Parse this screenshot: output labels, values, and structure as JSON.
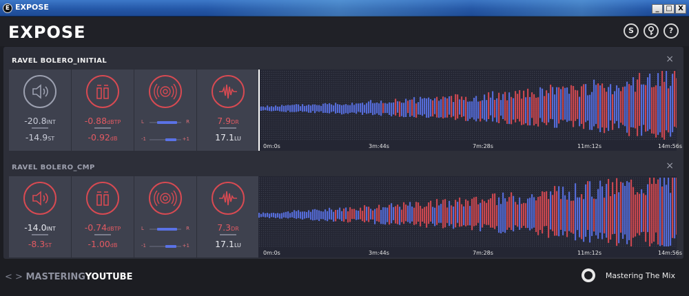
{
  "window": {
    "title": "EXPOSE",
    "app_icon": "E",
    "minimize": "_",
    "maximize": "□",
    "close": "X"
  },
  "header": {
    "logo": "EXPOSE",
    "buttons": [
      {
        "icon": "S"
      },
      {
        "icon": "key-icon"
      },
      {
        "icon": "?"
      }
    ]
  },
  "colors": {
    "red": "#d84a52",
    "blue": "#5a72e6",
    "background": "#2d2f39",
    "panel": "#3e414e"
  },
  "tracks": [
    {
      "title": "RAVEL BOLERO_INITIAL",
      "close": "×",
      "loudness": {
        "integrated": "-20.8",
        "integrated_unit": "INT",
        "short_term": "-14.9",
        "short_term_unit": "ST",
        "ok": true
      },
      "peak": {
        "true_peak": "-0.88",
        "true_peak_unit": "dBTP",
        "sample_peak": "-0.92",
        "sample_peak_unit": "dB"
      },
      "stereo": {
        "left_label": "L",
        "right_label": "R",
        "minus_label": "-1",
        "plus_label": "+1",
        "width_fraction": 0.78,
        "correlation_fraction": 0.85
      },
      "dynamics": {
        "dr": "7.9",
        "dr_unit": "DR",
        "lu": "17.1",
        "lu_unit": "LU"
      },
      "timeline": [
        "0m:0s",
        "3m:44s",
        "7m:28s",
        "11m:12s",
        "14m:56s"
      ]
    },
    {
      "title": "RAVEL BOLERO_CMP",
      "close": "×",
      "loudness": {
        "integrated": "-14.0",
        "integrated_unit": "INT",
        "short_term": "-8.3",
        "short_term_unit": "ST",
        "ok": false
      },
      "peak": {
        "true_peak": "-0.74",
        "true_peak_unit": "dBTP",
        "sample_peak": "-1.00",
        "sample_peak_unit": "dB"
      },
      "stereo": {
        "left_label": "L",
        "right_label": "R",
        "minus_label": "-1",
        "plus_label": "+1",
        "width_fraction": 0.78,
        "correlation_fraction": 0.85
      },
      "dynamics": {
        "dr": "7.3",
        "dr_unit": "DR",
        "lu": "17.1",
        "lu_unit": "LU"
      },
      "timeline": [
        "0m:0s",
        "3m:44s",
        "7m:28s",
        "11m:12s",
        "14m:56s"
      ]
    }
  ],
  "footer": {
    "arrows": "< >",
    "mastering": "MASTERING",
    "platform": "YOUTUBE",
    "company": "Mastering The Mix"
  }
}
